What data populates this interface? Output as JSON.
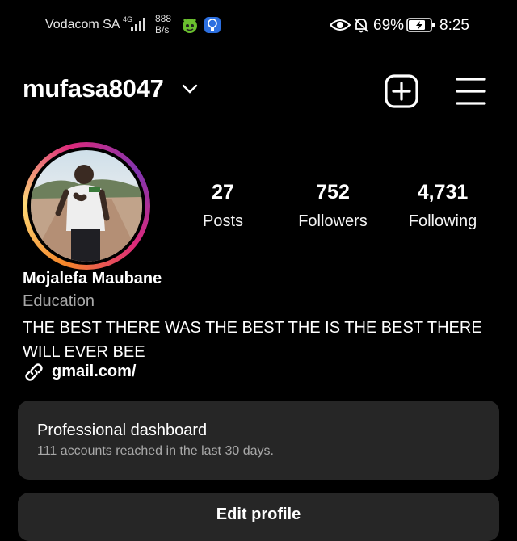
{
  "status_bar": {
    "carrier": "Vodacom SA",
    "network": "4G",
    "speed_value": "888",
    "speed_unit": "B/s",
    "battery_percent": "69%",
    "time": "8:25"
  },
  "header": {
    "username": "mufasa8047",
    "icons": [
      "chevron-down-icon",
      "create-plus-icon",
      "hamburger-menu-icon"
    ]
  },
  "stats": {
    "posts": {
      "value": "27",
      "label": "Posts"
    },
    "followers": {
      "value": "752",
      "label": "Followers"
    },
    "following": {
      "value": "4,731",
      "label": "Following"
    }
  },
  "bio": {
    "full_name": "Mojalefa Maubane",
    "category": "Education",
    "text": "THE BEST THERE WAS THE BEST THE IS THE BEST THERE WILL EVER BEE",
    "link": "gmail.com/"
  },
  "dashboard": {
    "title": "Professional dashboard",
    "subtitle": "111 accounts reached in the last 30 days."
  },
  "actions": {
    "edit_profile": "Edit profile"
  },
  "colors": {
    "background": "#000000",
    "card": "#262626",
    "secondary_text": "#a8a8a8"
  }
}
